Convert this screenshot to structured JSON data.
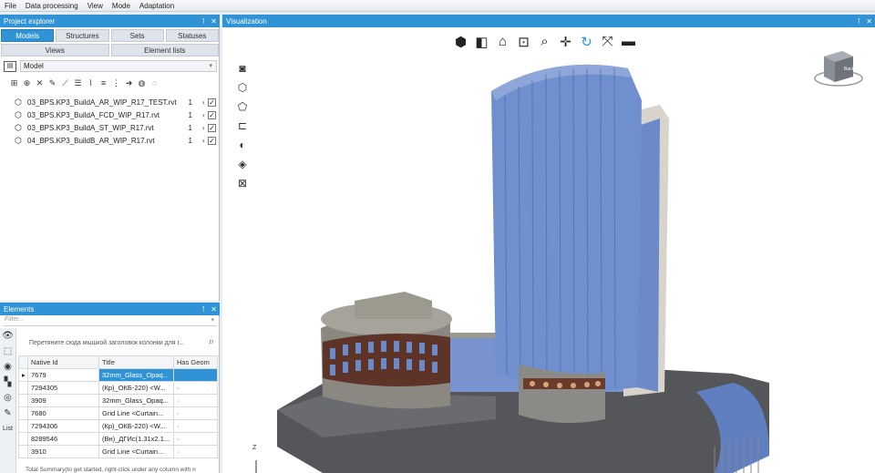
{
  "menu": [
    "File",
    "Data processing",
    "View",
    "Mode",
    "Adaptation"
  ],
  "project_explorer": {
    "title": "Project explorer",
    "tabs_row1": [
      "Models",
      "Structures",
      "Sets",
      "Statuses"
    ],
    "tabs_row2": [
      "Views",
      "Element lists"
    ],
    "dropdown_value": "Model",
    "models": [
      {
        "name": "03_BPS.KP3_BuildA_AR_WIP_R17_TEST.rvt",
        "count": "1"
      },
      {
        "name": "03_BPS.KP3_BuildA_FCD_WIP_R17.rvt",
        "count": "1"
      },
      {
        "name": "03_BPS.KP3_BuildA_ST_WIP_R17.rvt",
        "count": "1"
      },
      {
        "name": "04_BPS.KP3_BuildB_AR_WIP_R17.rvt",
        "count": "1"
      }
    ]
  },
  "elements": {
    "title": "Elements",
    "filter_placeholder": "Filter...",
    "group_hint": "Перетяните сюда мышкой заголовок колонки для г...",
    "left_label": "List",
    "columns": [
      "Native Id",
      "Title",
      "Has Geom"
    ],
    "rows": [
      {
        "id": "7679",
        "title": "32mm_Glass_Opaq...",
        "geom": ""
      },
      {
        "id": "7294305",
        "title": "(Кр)_ОКБ-220) <W...",
        "geom": "·"
      },
      {
        "id": "3909",
        "title": "32mm_Glass_Opaq...",
        "geom": "·"
      },
      {
        "id": "7680",
        "title": "Grid Line <Curtain...",
        "geom": "·"
      },
      {
        "id": "7294306",
        "title": "(Кр)_ОКБ-220) <W...",
        "geom": "·"
      },
      {
        "id": "8289546",
        "title": "(Вн)_ДГИс(1.31x2.1...",
        "geom": "·"
      },
      {
        "id": "3910",
        "title": "Grid Line <Curtain...",
        "geom": "·"
      }
    ],
    "summary": "Total Summary(to get started, right-click under any column with n"
  },
  "visualization": {
    "title": "Visualization",
    "axis_label": "Z",
    "navcube_label": "Back"
  },
  "colors": {
    "accent": "#2f93d6",
    "glass": "#6f8fcf",
    "concrete": "#8c8a86",
    "brick": "#6a3a2a"
  }
}
